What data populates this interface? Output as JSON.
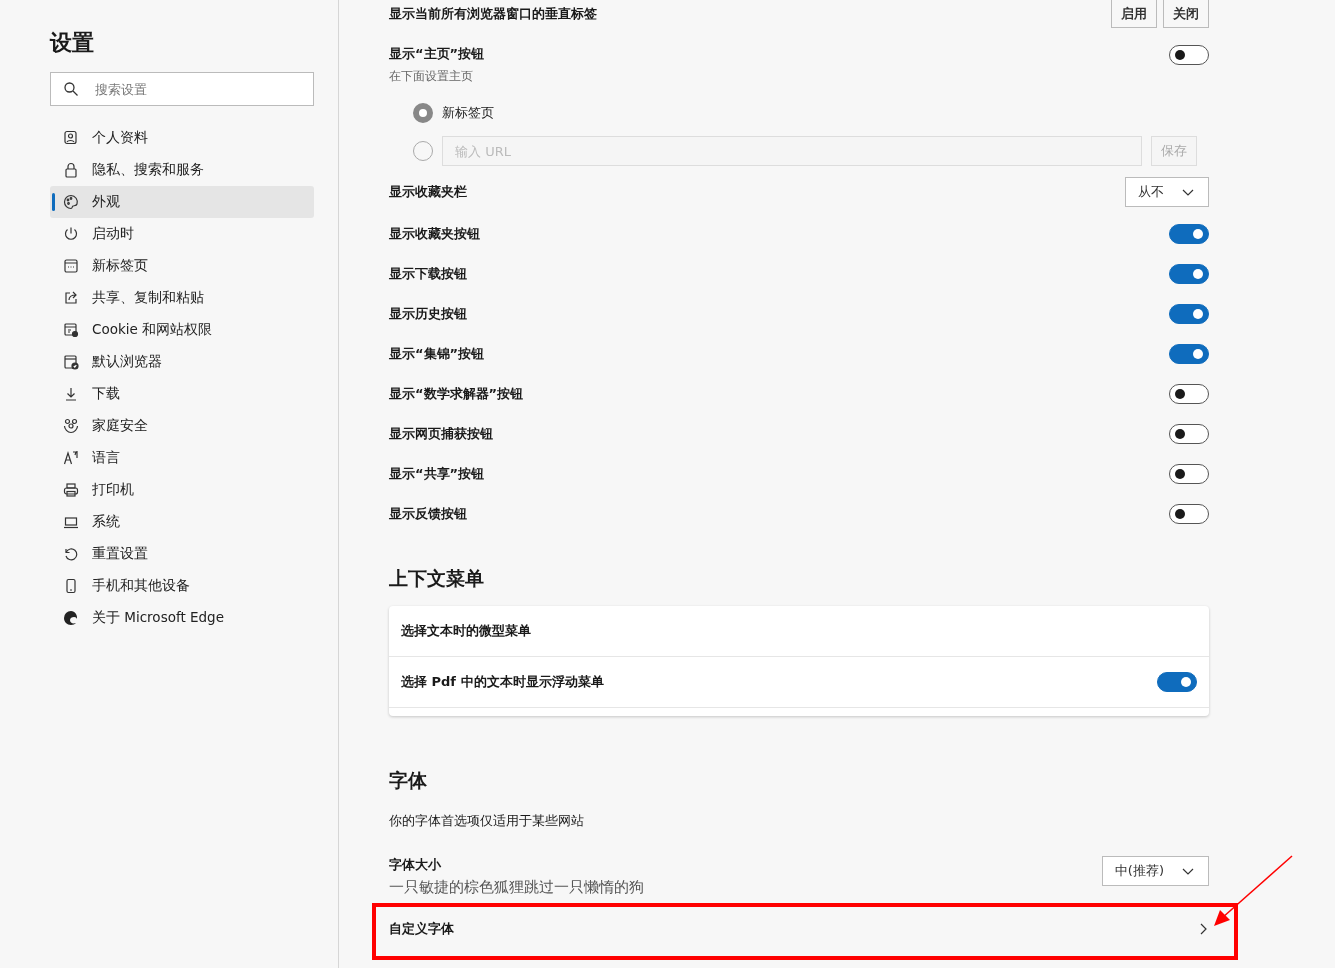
{
  "sidebar": {
    "title": "设置",
    "search": {
      "placeholder": "搜索设置"
    },
    "items": [
      {
        "label": "个人资料",
        "selected": false
      },
      {
        "label": "隐私、搜索和服务",
        "selected": false
      },
      {
        "label": "外观",
        "selected": true
      },
      {
        "label": "启动时",
        "selected": false
      },
      {
        "label": "新标签页",
        "selected": false
      },
      {
        "label": "共享、复制和粘贴",
        "selected": false
      },
      {
        "label": "Cookie 和网站权限",
        "selected": false
      },
      {
        "label": "默认浏览器",
        "selected": false
      },
      {
        "label": "下载",
        "selected": false
      },
      {
        "label": "家庭安全",
        "selected": false
      },
      {
        "label": "语言",
        "selected": false
      },
      {
        "label": "打印机",
        "selected": false
      },
      {
        "label": "系统",
        "selected": false
      },
      {
        "label": "重置设置",
        "selected": false
      },
      {
        "label": "手机和其他设备",
        "selected": false
      },
      {
        "label": "关于 Microsoft Edge",
        "selected": false
      }
    ]
  },
  "appearance_rows": [
    {
      "kind": "buttons",
      "label": "显示当前所有浏览器窗口的垂直标签",
      "buttons": [
        "启用",
        "关闭"
      ]
    },
    {
      "kind": "toggle",
      "label": "显示“主页”按钮",
      "sublabel": "在下面设置主页",
      "on": false
    },
    {
      "kind": "radio",
      "label": "新标签页",
      "selected": true
    },
    {
      "kind": "radio_url",
      "placeholder": "输入 URL",
      "button": "保存",
      "selected": false
    },
    {
      "kind": "dropdown",
      "label": "显示收藏夹栏",
      "value": "从不"
    },
    {
      "kind": "toggle",
      "label": "显示收藏夹按钮",
      "on": true
    },
    {
      "kind": "toggle",
      "label": "显示下载按钮",
      "on": true
    },
    {
      "kind": "toggle",
      "label": "显示历史按钮",
      "on": true
    },
    {
      "kind": "toggle",
      "label": "显示“集锦”按钮",
      "on": true
    },
    {
      "kind": "toggle",
      "label": "显示“数学求解器”按钮",
      "on": false
    },
    {
      "kind": "toggle",
      "label": "显示网页捕获按钮",
      "on": false
    },
    {
      "kind": "toggle",
      "label": "显示“共享”按钮",
      "on": false
    },
    {
      "kind": "toggle",
      "label": "显示反馈按钮",
      "on": false
    }
  ],
  "context_menu": {
    "title": "上下文菜单",
    "rows": [
      {
        "kind": "plain",
        "label": "选择文本时的微型菜单"
      },
      {
        "kind": "toggle",
        "label": "选择 Pdf 中的文本时显示浮动菜单",
        "on": true
      }
    ]
  },
  "fonts": {
    "title": "字体",
    "description": "你的字体首选项仅适用于某些网站",
    "rows": [
      {
        "kind": "dropdown",
        "label": "字体大小",
        "value": "中(推荐)",
        "sample": "一只敏捷的棕色狐狸跳过一只懒惰的狗"
      },
      {
        "kind": "link",
        "label": "自定义字体"
      }
    ]
  }
}
